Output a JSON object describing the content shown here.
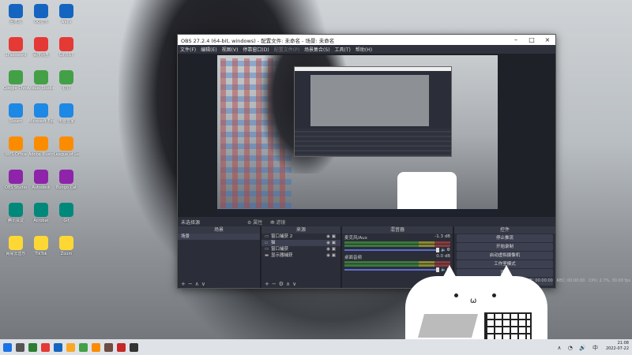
{
  "obs": {
    "title": "OBS 27.2.4 (64-bit, windows) - 配置文件: 未命名 - 场景: 未命名",
    "menu": [
      "文件(F)",
      "编辑(E)",
      "视图(V)",
      "停靠窗口(D)",
      "配置文件(P)",
      "场景集合(S)",
      "工具(T)",
      "帮助(H)"
    ],
    "scene_label": "未选择源",
    "props_btn": "属性",
    "filters_btn": "滤镜",
    "docks": {
      "scenes": "场景",
      "sources": "来源",
      "mixer": "混音器",
      "controls": "控件"
    },
    "scenes": [
      "场景"
    ],
    "sources": [
      "窗口捕获 2",
      "猫",
      "窗口捕获",
      "显示器捕获"
    ],
    "mixer": [
      {
        "name": "麦克风/Aux",
        "db": "-1.3 dB"
      },
      {
        "name": "桌面音频",
        "db": "0.0 dB"
      }
    ],
    "controls": [
      "停止推流",
      "开始录制",
      "启动虚拟摄像机",
      "工作室模式",
      "设置",
      "退出"
    ],
    "status": {
      "live": "LIVE: 00:00:00",
      "rec": "REC: 00:00:00",
      "cpu": "CPU: 2.7%, 30.00 fps"
    }
  },
  "desktop_icons": [
    "回收站",
    "1Password",
    "Google Chrome",
    "Steam",
    "WPS Office",
    "OBS Studio",
    "腾讯会议",
    "网易云音乐",
    "QQ音乐",
    "百度网盘",
    "Visual Studio",
    "Microsoft Edge",
    "Adobe Illustrator",
    "Autodesk",
    "Acrobat",
    "TikTok",
    "wejlv",
    "Gift567",
    "钉钉",
    "电脑管家",
    "League of Legends",
    "Bongo Cat",
    "Git",
    "Zoom"
  ],
  "taskbar": {
    "time": "21:08",
    "date": "2022-07-22"
  }
}
